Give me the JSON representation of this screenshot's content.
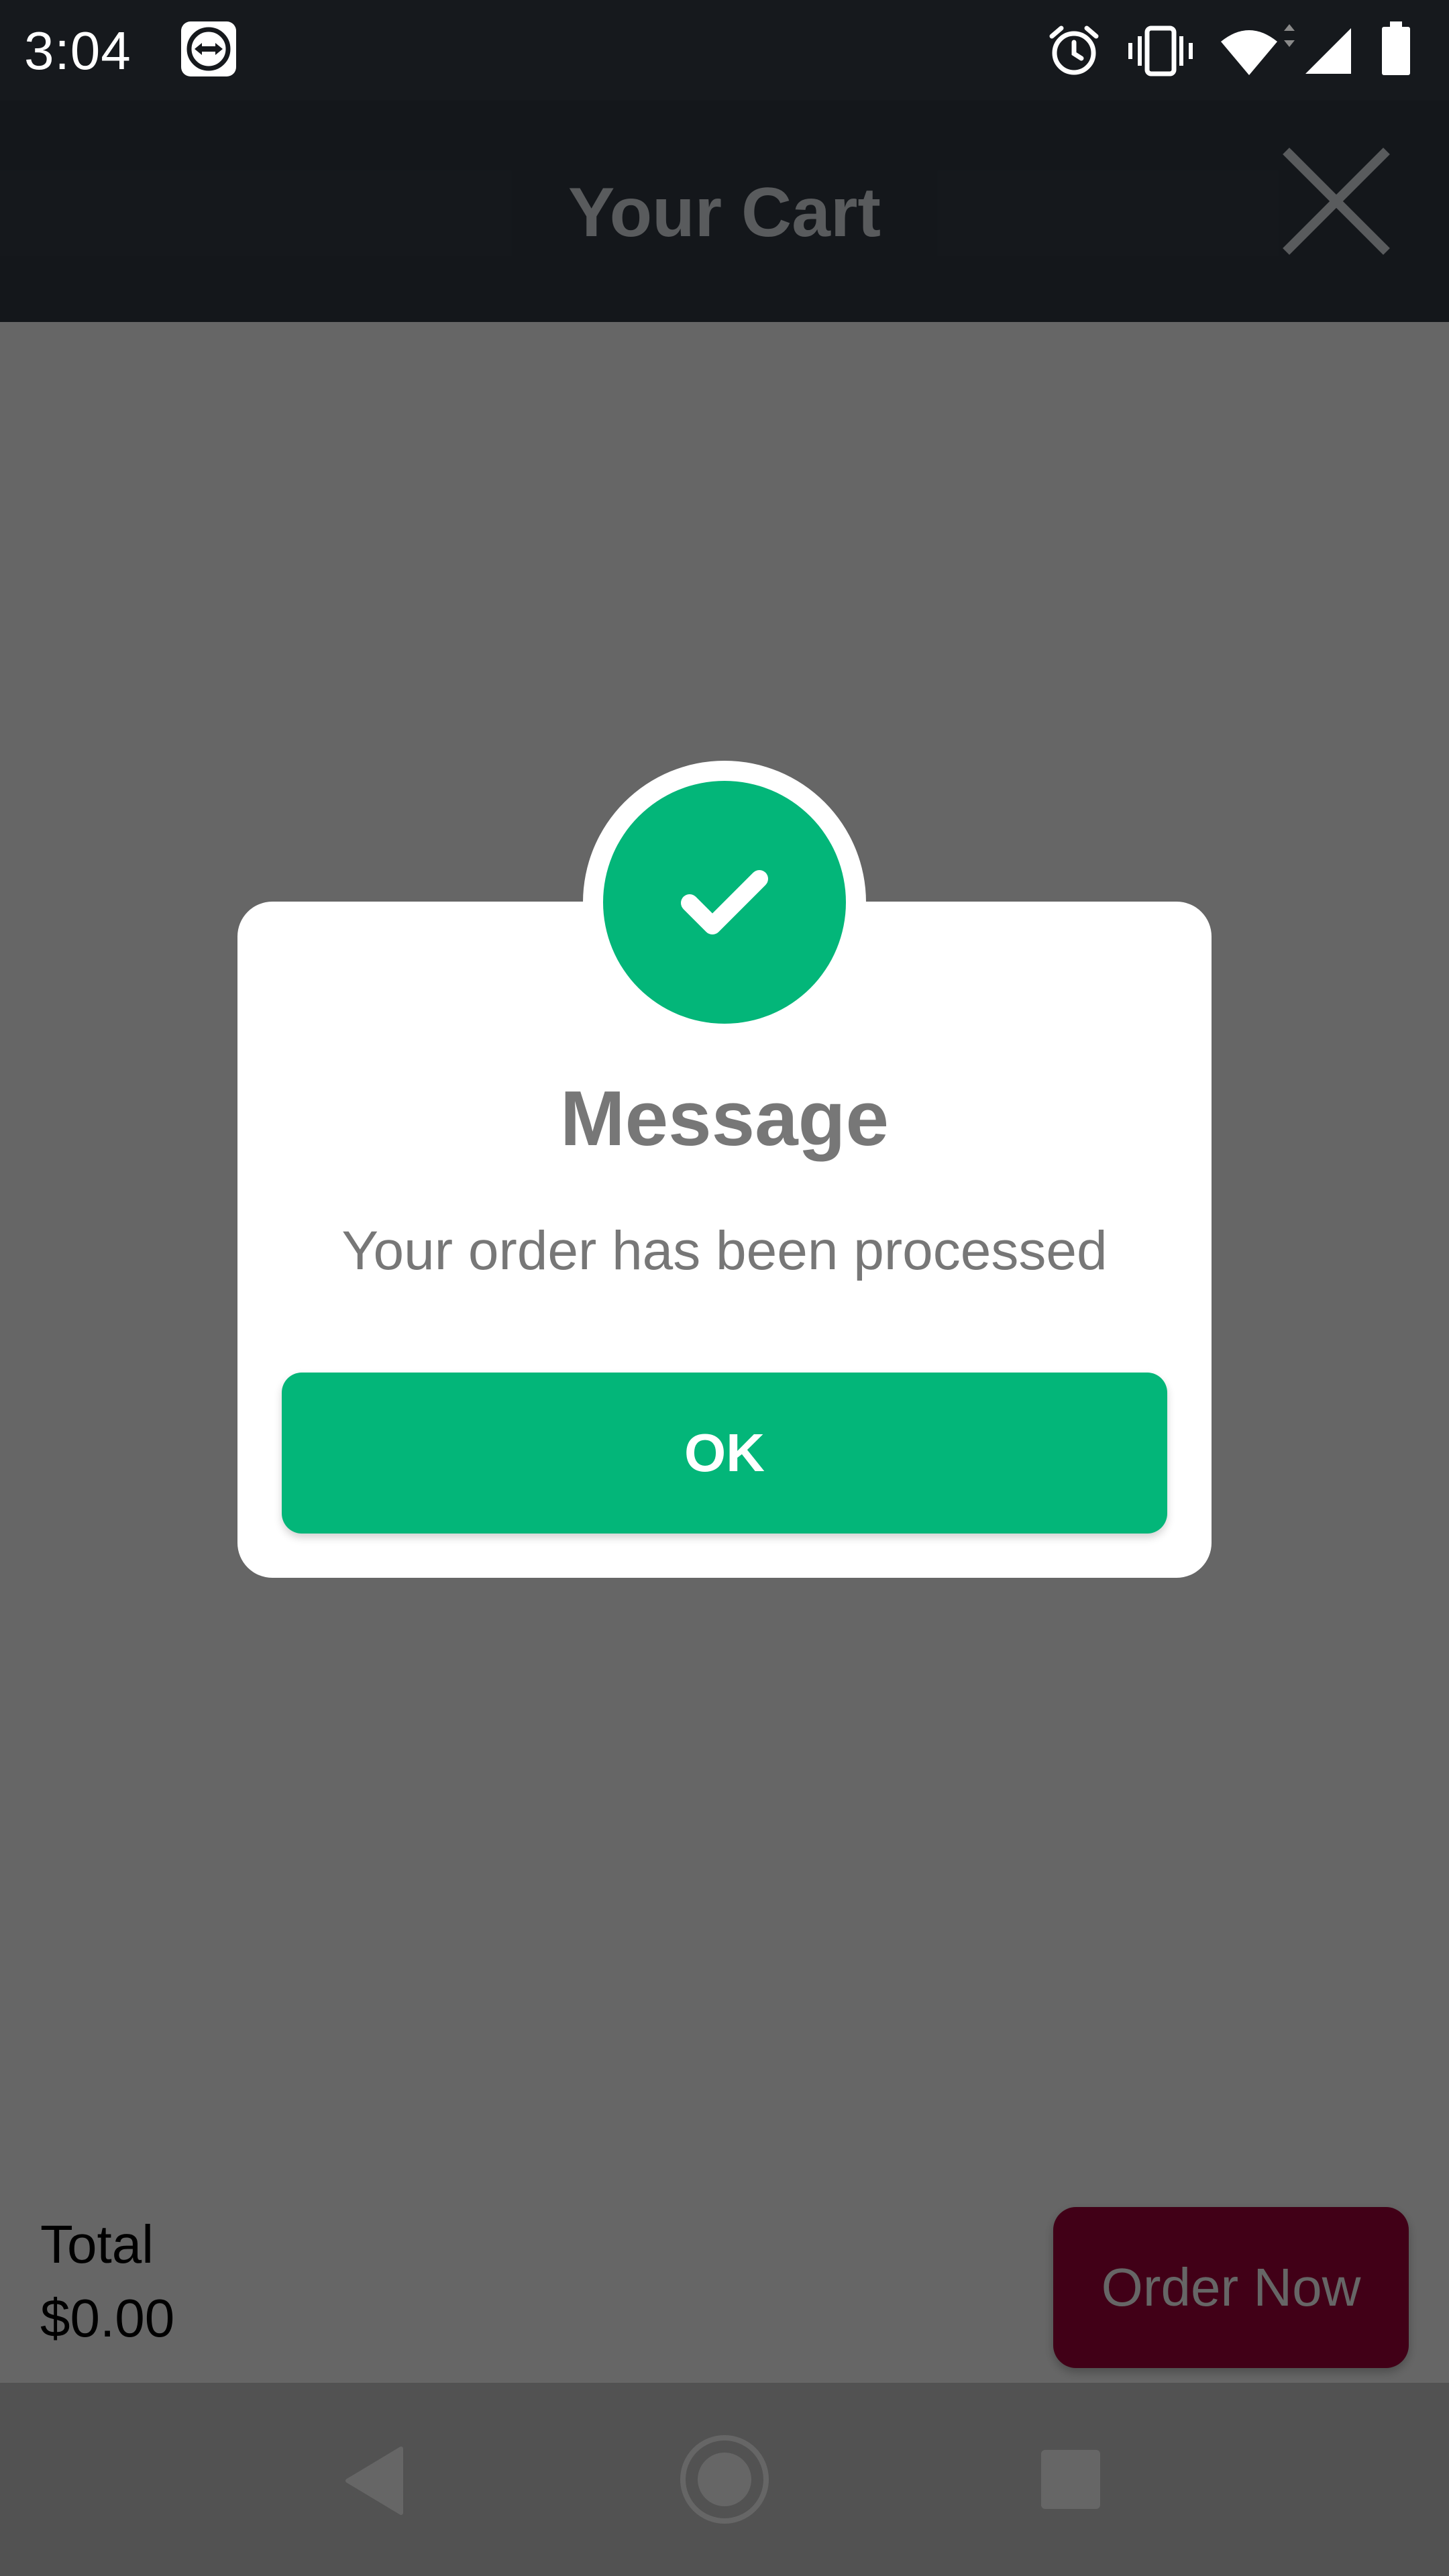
{
  "status_bar": {
    "time": "3:04",
    "icons": [
      "teamviewer-icon",
      "alarm-icon",
      "vibrate-icon",
      "wifi-icon",
      "signal-icon",
      "battery-icon"
    ]
  },
  "header": {
    "title": "Your Cart",
    "close_icon": "close-icon"
  },
  "footer": {
    "total_label": "Total",
    "total_value": "$0.00",
    "order_button_label": "Order Now"
  },
  "dialog": {
    "icon": "check-icon",
    "title": "Message",
    "message": "Your order has been processed",
    "ok_label": "OK"
  },
  "nav_bar": {
    "buttons": [
      "back-icon",
      "home-icon",
      "recents-icon"
    ]
  },
  "colors": {
    "success": "#03b679",
    "order_button": "#a3003a",
    "app_bar": "#16191d"
  }
}
